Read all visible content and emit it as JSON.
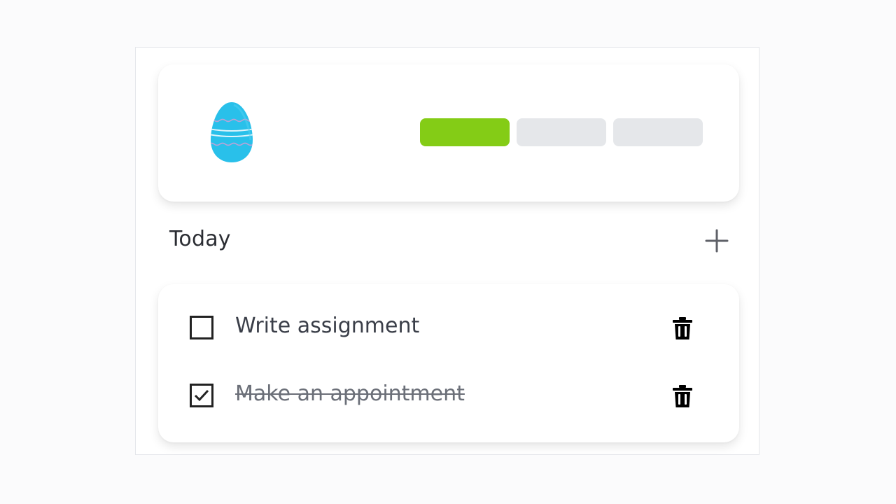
{
  "header": {
    "mascot_icon": "easter-egg-icon",
    "egg_color": "#29c0ea",
    "progress": {
      "segments": 3,
      "completed": 1,
      "done_color": "#84cc16",
      "todo_color": "#e5e7ea"
    }
  },
  "section": {
    "title": "Today",
    "add_icon": "plus-icon"
  },
  "tasks": [
    {
      "label": "Write assignment",
      "checked": false,
      "delete_icon": "trash-icon"
    },
    {
      "label": "Make an appointment",
      "checked": true,
      "delete_icon": "trash-icon"
    }
  ]
}
